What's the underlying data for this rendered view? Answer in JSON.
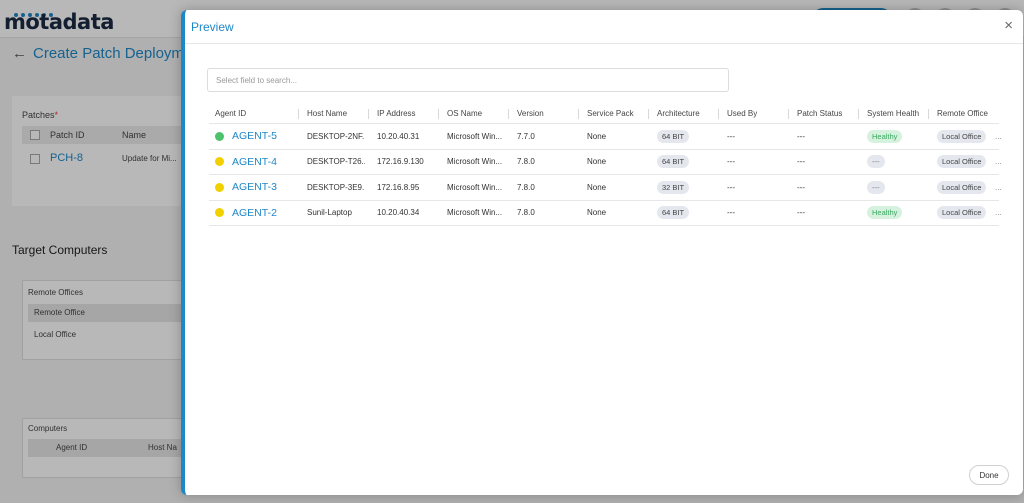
{
  "app": {
    "logo_text": "motadata"
  },
  "background": {
    "page_title": "Create Patch Deployme",
    "patches_section_label": "Patches",
    "patches_table_headers": [
      "Patch ID",
      "Name"
    ],
    "patches_rows": [
      {
        "patch_id": "PCH-8",
        "name": "Update for Mi..."
      }
    ],
    "target_computers_title": "Target Computers",
    "remote_offices_label": "Remote Offices",
    "remote_offices_items": [
      "Remote Office",
      "Local Office"
    ],
    "computers_label": "Computers",
    "computers_table_headers": [
      "Agent ID",
      "Host Na"
    ]
  },
  "modal": {
    "title": "Preview",
    "close_glyph": "×",
    "search_placeholder": "Select field to search...",
    "done_label": "Done",
    "columns": [
      "Agent ID",
      "Host Name",
      "IP Address",
      "OS Name",
      "Version",
      "Service Pack",
      "Architecture",
      "Used By",
      "Patch Status",
      "System Health",
      "Remote Office"
    ],
    "more_glyph": "...",
    "rows": [
      {
        "status_color": "#4cc36b",
        "agent_id": "AGENT-5",
        "host_name": "DESKTOP-2NF...",
        "ip": "10.20.40.31",
        "os": "Microsoft Win...",
        "version": "7.7.0",
        "service_pack": "None",
        "architecture": "64 BIT",
        "used_by": "---",
        "patch_status": "---",
        "health": "Healthy",
        "health_ok": true,
        "remote_office": "Local Office"
      },
      {
        "status_color": "#f2d000",
        "agent_id": "AGENT-4",
        "host_name": "DESKTOP-T26...",
        "ip": "172.16.9.130",
        "os": "Microsoft Win...",
        "version": "7.8.0",
        "service_pack": "None",
        "architecture": "64 BIT",
        "used_by": "---",
        "patch_status": "---",
        "health": "---",
        "health_ok": false,
        "remote_office": "Local Office"
      },
      {
        "status_color": "#f2d000",
        "agent_id": "AGENT-3",
        "host_name": "DESKTOP-3E9...",
        "ip": "172.16.8.95",
        "os": "Microsoft Win...",
        "version": "7.8.0",
        "service_pack": "None",
        "architecture": "32 BIT",
        "used_by": "---",
        "patch_status": "---",
        "health": "---",
        "health_ok": false,
        "remote_office": "Local Office"
      },
      {
        "status_color": "#f2d000",
        "agent_id": "AGENT-2",
        "host_name": "Sunil-Laptop",
        "ip": "10.20.40.34",
        "os": "Microsoft Win...",
        "version": "7.8.0",
        "service_pack": "None",
        "architecture": "64 BIT",
        "used_by": "---",
        "patch_status": "---",
        "health": "Healthy",
        "health_ok": true,
        "remote_office": "Local Office"
      }
    ]
  }
}
